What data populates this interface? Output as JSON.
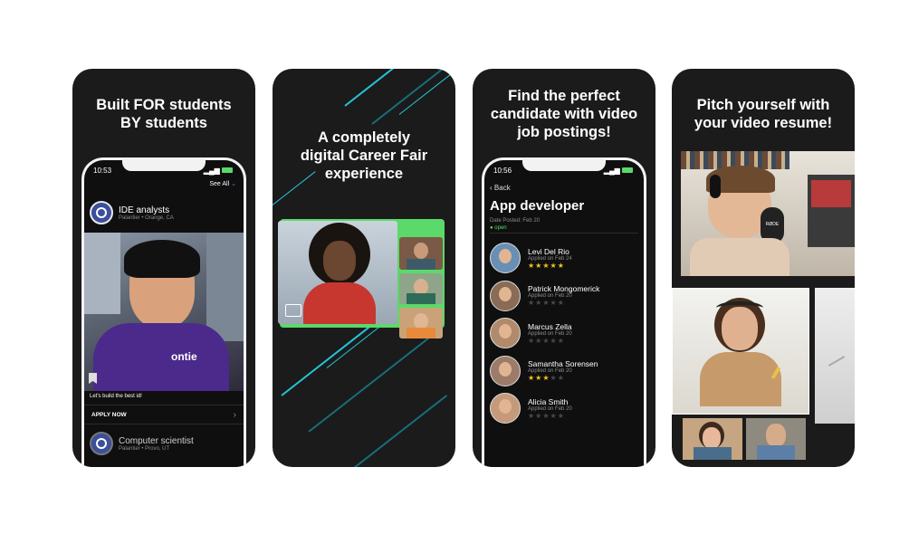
{
  "colors": {
    "accent": "#23c6d8",
    "green": "#5bd96a",
    "star": "#f5c518",
    "card_bg": "#1b1b1b"
  },
  "panel1": {
    "title": "Built FOR students\nBY students",
    "time": "10:53",
    "see_all": "See All",
    "job1": {
      "title": "IDE analysts",
      "subtitle": "Palantier • Orange, CA"
    },
    "video_text": "ontie",
    "caption": "Let's build the best id!",
    "apply": "APPLY NOW",
    "job2": {
      "title": "Computer scientist",
      "subtitle": "Palantier • Provo, UT"
    }
  },
  "panel2": {
    "title": "A completely\ndigital Career Fair\nexperience"
  },
  "panel3": {
    "title": "Find the perfect\ncandidate with video\njob postings!",
    "time": "10:56",
    "back": "Back",
    "job_title": "App developer",
    "date_posted": "Date Posted: Feb 20",
    "status": "● open",
    "candidates": [
      {
        "name": "Levi Del Rio",
        "applied": "Applied on Feb 24",
        "rating": 5,
        "color": "#6a8fb5"
      },
      {
        "name": "Patrick Mongomerick",
        "applied": "Applied on Feb 20",
        "rating": 0,
        "color": "#8a6b55"
      },
      {
        "name": "Marcus Zella",
        "applied": "Applied on Feb 20",
        "rating": 0,
        "color": "#b08a6a"
      },
      {
        "name": "Samantha Sorensen",
        "applied": "Applied on Feb 20",
        "rating": 3,
        "color": "#9c7b6a"
      },
      {
        "name": "Alicia Smith",
        "applied": "Applied on Feb 20",
        "rating": 0,
        "color": "#c49a7a"
      }
    ]
  },
  "panel4": {
    "title": "Pitch yourself with\nyour video resume!",
    "mic_label": "RØDE"
  }
}
